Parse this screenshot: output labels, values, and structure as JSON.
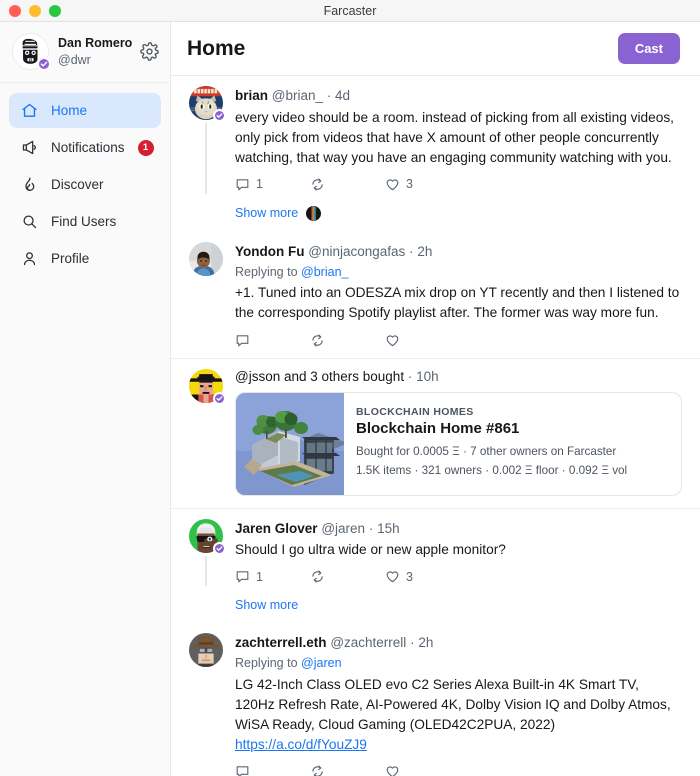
{
  "window": {
    "title": "Farcaster"
  },
  "sidebar": {
    "profile": {
      "name": "Dan Romero",
      "handle": "@dwr",
      "settings_label": "Settings"
    },
    "items": [
      {
        "label": "Home",
        "icon": "home-icon",
        "active": true,
        "badge": ""
      },
      {
        "label": "Notifications",
        "icon": "bell-megaphone-icon",
        "active": false,
        "badge": "1"
      },
      {
        "label": "Discover",
        "icon": "flame-icon",
        "active": false,
        "badge": ""
      },
      {
        "label": "Find Users",
        "icon": "search-icon",
        "active": false,
        "badge": ""
      },
      {
        "label": "Profile",
        "icon": "person-icon",
        "active": false,
        "badge": ""
      }
    ]
  },
  "header": {
    "title": "Home",
    "cast_button": "Cast"
  },
  "feed": [
    {
      "id": "brian-cast",
      "author": "brian",
      "handle": "@brian_",
      "time": "4d",
      "text": "every video should be a room. instead of picking from all existing videos, only pick from videos that have X amount of other people concurrently watching, that way you have an engaging community watching with you.",
      "actions": {
        "reply": "1",
        "recast": "",
        "like": "3"
      },
      "show_more": "Show more"
    },
    {
      "id": "yondon-reply",
      "author": "Yondon Fu",
      "handle": "@ninjacongafas",
      "time": "2h",
      "replying_prefix": "Replying to",
      "replying_to": "@brian_",
      "text": "+1. Tuned into an ODESZA mix drop on YT recently and then I listened to the corresponding Spotify playlist after. The former was way more fun.",
      "actions": {
        "reply": "",
        "recast": "",
        "like": ""
      }
    },
    {
      "id": "jsson-nft",
      "header_text": "@jsson and 3 others bought",
      "time": "10h",
      "nft": {
        "collection": "BLOCKCHAIN HOMES",
        "title": "Blockchain Home #861",
        "meta_line_1": "Bought for 0.0005 Ξ · 7 other owners on Farcaster",
        "meta_line_2": "1.5K items · 321 owners · 0.002 Ξ floor · 0.092 Ξ vol"
      }
    },
    {
      "id": "jaren-cast",
      "author": "Jaren Glover",
      "handle": "@jaren",
      "time": "15h",
      "text": "Should I go ultra wide or new apple monitor?",
      "actions": {
        "reply": "1",
        "recast": "",
        "like": "3"
      },
      "show_more": "Show more"
    },
    {
      "id": "zach-reply",
      "author": "zachterrell.eth",
      "handle": "@zachterrell",
      "time": "2h",
      "replying_prefix": "Replying to",
      "replying_to": "@jaren",
      "text": "LG 42-Inch Class OLED evo C2 Series Alexa Built-in 4K Smart TV, 120Hz Refresh Rate, AI-Powered 4K, Dolby Vision IQ and Dolby Atmos, WiSA Ready, Cloud Gaming (OLED42C2PUA, 2022)",
      "link": "https://a.co/d/fYouZJ9",
      "actions": {
        "reply": "",
        "recast": "",
        "like": ""
      }
    }
  ],
  "colors": {
    "accent_blue": "#1b76f2",
    "accent_purple": "#8a63d2",
    "badge_red": "#d32030",
    "active_nav_bg": "#d9e8fd"
  }
}
